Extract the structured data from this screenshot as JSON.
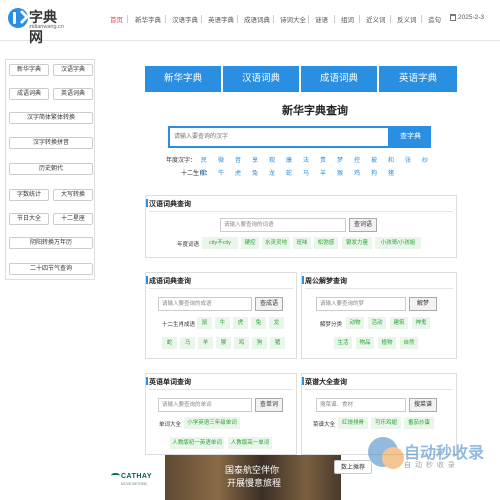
{
  "logo": {
    "text": "字典网",
    "sub": "zidianwang.cn"
  },
  "nav": {
    "items": [
      "首页",
      "新华字典",
      "汉语字典",
      "英语字典",
      "成语词典",
      "诗词大全",
      "谜语",
      "组词",
      "近义词",
      "反义词",
      "造句"
    ],
    "date": "2025-2-3"
  },
  "sidebar": {
    "items": [
      "新华字典",
      "汉语字典",
      "成语词典",
      "英语词典",
      "汉字简体繁体转换",
      "汉字转换拼音",
      "历史朝代",
      "字数统计",
      "大写转换",
      "节日大全",
      "十二星座",
      "阴阳转换万年历",
      "二十四节气查询"
    ]
  },
  "tabs": [
    "新华字典",
    "汉语词典",
    "成语词典",
    "英语字典"
  ],
  "main": {
    "title": "新华字典查询",
    "placeholder": "请输入要查询的汉字",
    "button": "查字典",
    "year_label": "年度汉字：",
    "year_chars": [
      "民",
      "微",
      "音",
      "享",
      "观",
      "康",
      "法",
      "贵",
      "梦",
      "控",
      "被",
      "和",
      "张",
      "纱"
    ],
    "zodiac_label": "十二生肖：",
    "zodiac_chars": [
      "鼠",
      "牛",
      "虎",
      "兔",
      "龙",
      "蛇",
      "马",
      "羊",
      "猴",
      "鸡",
      "狗",
      "猪"
    ]
  },
  "ci": {
    "title": "汉语词典查询",
    "placeholder": "请输入要查询的词语",
    "button": "查词语",
    "label": "年度词语",
    "chips": [
      "city不city",
      "硬控",
      "水灵灵地",
      "班味",
      "松弛感",
      "银发力量",
      "小孩哥/小孩姐"
    ]
  },
  "chengyu": {
    "title": "成语词典查询",
    "placeholder": "请输入要查询的成语",
    "button": "查成语",
    "label": "十二生肖成语",
    "chips": [
      "鼠",
      "牛",
      "虎",
      "兔",
      "龙",
      "蛇",
      "马",
      "羊",
      "猴",
      "鸡",
      "狗",
      "猪"
    ]
  },
  "meng": {
    "title": "周公解梦查询",
    "placeholder": "请输入要查询的梦",
    "button": "解梦",
    "label": "解梦分类",
    "chips": [
      "动物",
      "活动",
      "建筑",
      "神鬼",
      "生活",
      "物品",
      "植物",
      "自然"
    ]
  },
  "en": {
    "title": "英语单词查询",
    "placeholder": "请输入要查询的单词",
    "button": "查单词",
    "label": "单词大全",
    "chips": [
      "小学英语三年级单词",
      "人教版初一英语单词",
      "人教版高一单词"
    ]
  },
  "cai": {
    "title": "菜谱大全查询",
    "placeholder": "搜菜谱、食材",
    "button": "搜菜谱",
    "label": "菜谱大全",
    "chips": [
      "红烧排骨",
      "可乐鸡翅",
      "番茄炒蛋"
    ]
  },
  "ad": {
    "brand": "CATHAY",
    "brand_sub": "MOVE BEYOND",
    "line1": "国泰航空伴你",
    "line2": "开展慢意旅程",
    "cta": "数上摊荐"
  },
  "watermark": {
    "title": "自动秒收录",
    "sub": "自 动 秒 收 录"
  }
}
